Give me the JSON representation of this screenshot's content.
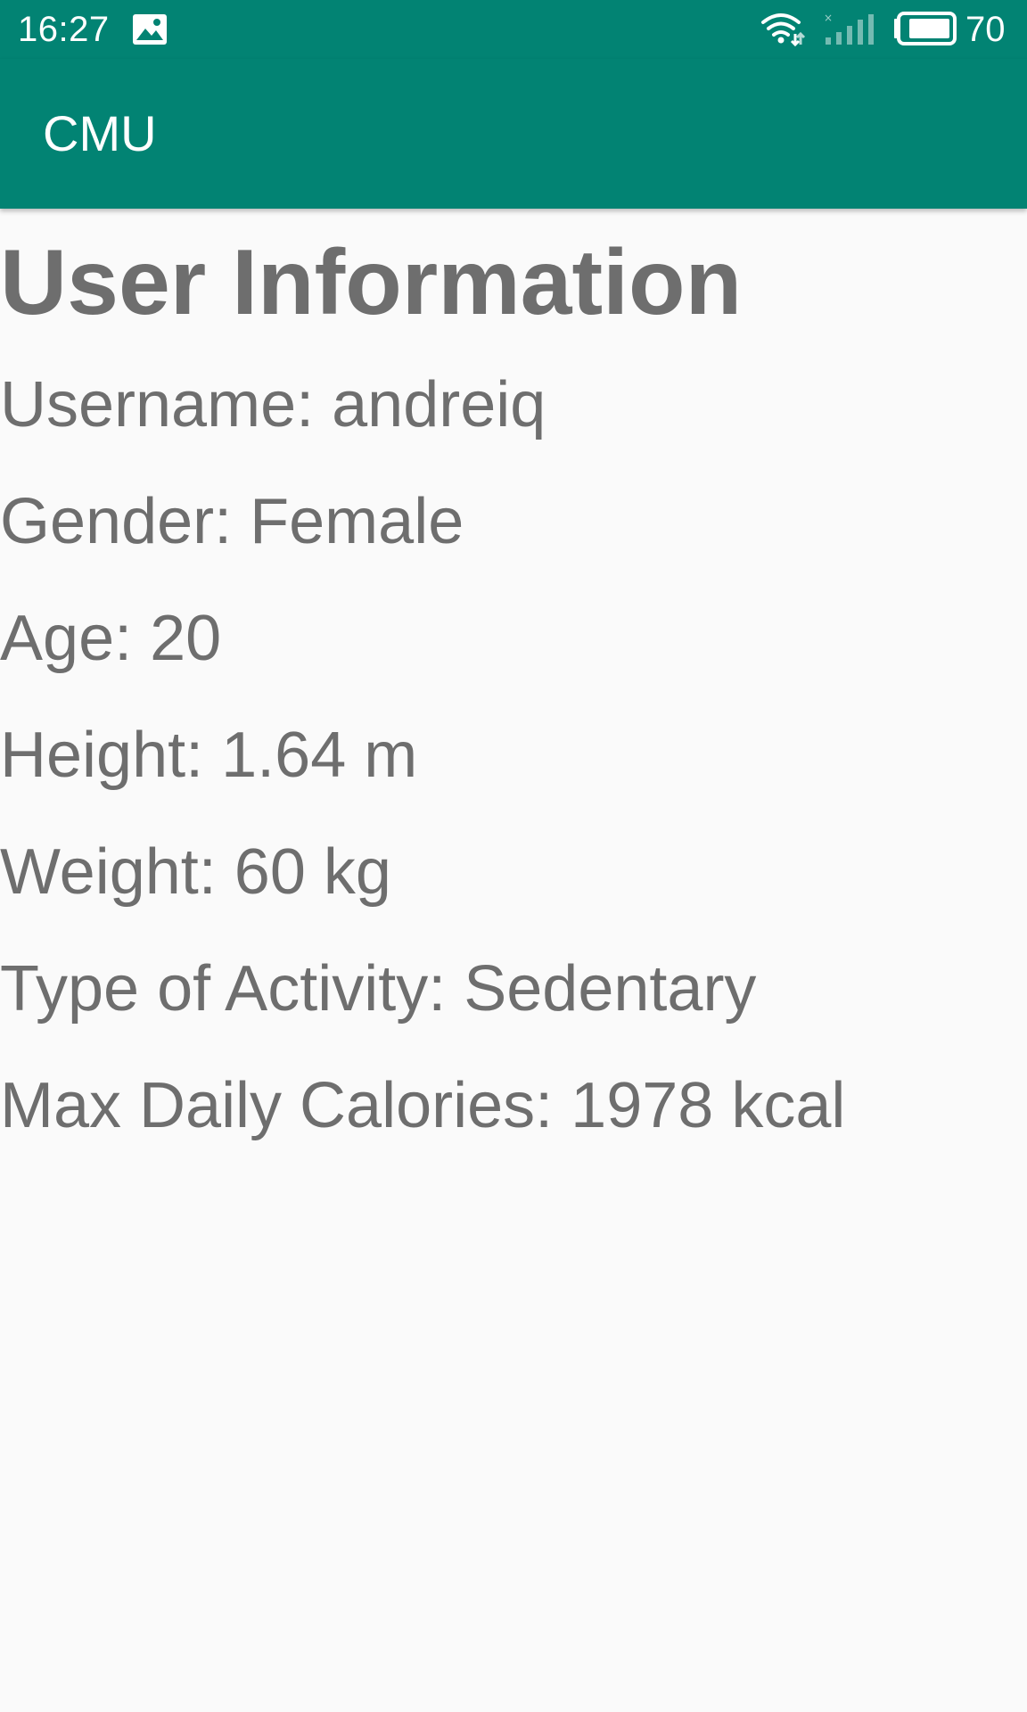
{
  "status_bar": {
    "time": "16:27",
    "battery_level": "70",
    "icons": [
      "image-notification-icon",
      "wifi-icon",
      "cell-signal-icon",
      "battery-icon"
    ]
  },
  "app_bar": {
    "title": "CMU",
    "color": "#028373"
  },
  "user_info": {
    "heading": "User Information",
    "username": "Username: andreiq",
    "gender": "Gender: Female",
    "age": "Age: 20",
    "height": "Height: 1.64 m",
    "weight": "Weight: 60 kg",
    "activity": "Type of Activity: Sedentary",
    "max_calories": "Max Daily Calories: 1978 kcal"
  }
}
